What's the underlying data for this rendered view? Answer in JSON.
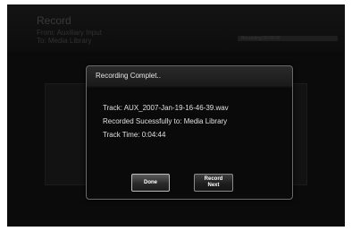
{
  "background": {
    "title": "Record",
    "from": "From: Auxiliary Input",
    "to": "To: Media Library",
    "progress_text": "Recording 00:00:00"
  },
  "dialog": {
    "title": "Recording Complet..",
    "track": "Track: AUX_2007-Jan-19-16-46-39.wav",
    "recorded": "Recorded Sucessfully to: Media Library",
    "track_time": "Track Time: 0:04:44",
    "buttons": {
      "done": "Done",
      "record_next_line1": "Record",
      "record_next_line2": "Next"
    }
  },
  "colors": {
    "screen_bg": "#0b0b0b",
    "dialog_border": "#6a6a6a",
    "text": "#e0e0e0"
  }
}
